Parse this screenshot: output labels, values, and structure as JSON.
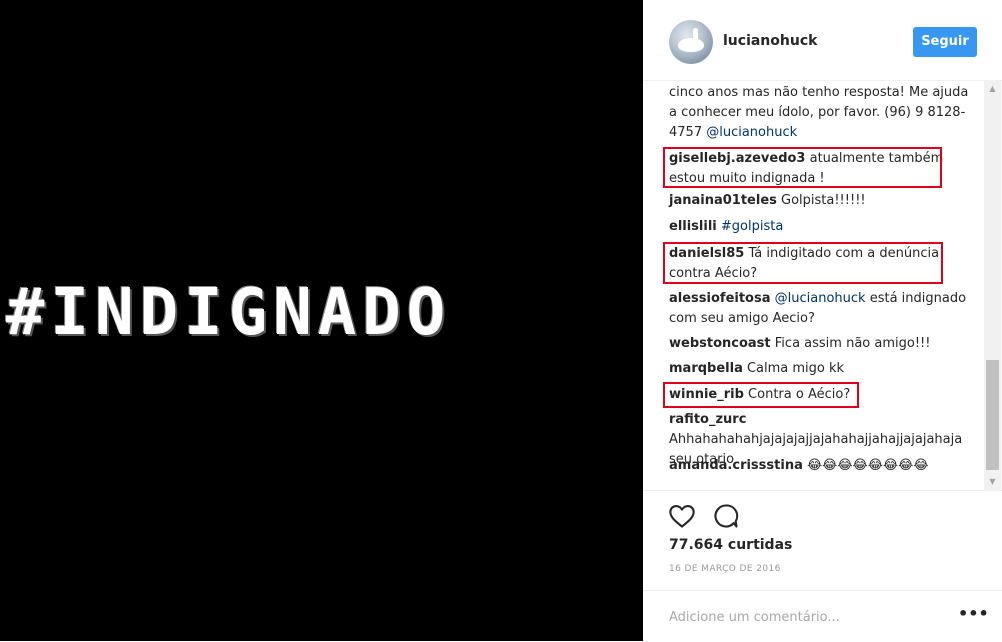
{
  "media": {
    "text": "#INDIGNADO"
  },
  "header": {
    "username": "lucianohuck",
    "follow_label": "Seguir"
  },
  "comments": [
    {
      "user": "",
      "parts": [
        {
          "text": "cinco anos mas não tenho resposta! Me ajuda a conhecer meu ídolo, por favor. (96) 9 8128-4757 "
        },
        {
          "text": "@lucianohuck",
          "mention": true
        }
      ]
    },
    {
      "user": "gisellebj.azevedo3",
      "parts": [
        {
          "text": " atualmente também estou muito indignada !"
        }
      ]
    },
    {
      "user": "janaina01teles",
      "parts": [
        {
          "text": " Golpista!!!!!!"
        }
      ]
    },
    {
      "user": "ellislili",
      "parts": [
        {
          "text": " "
        },
        {
          "text": "#golpista",
          "mention": true
        }
      ]
    },
    {
      "user": "danielsl85",
      "parts": [
        {
          "text": " Tá indigitado com a denúncia contra Aécio?"
        }
      ]
    },
    {
      "user": "alessiofeitosa",
      "parts": [
        {
          "text": " "
        },
        {
          "text": "@lucianohuck",
          "mention": true
        },
        {
          "text": " está indignado com seu amigo Aecio?"
        }
      ]
    },
    {
      "user": "webstoncoast",
      "parts": [
        {
          "text": " Fica assim não amigo!!!"
        }
      ]
    },
    {
      "user": "marqbella",
      "parts": [
        {
          "text": " Calma migo kk"
        }
      ]
    },
    {
      "user": "winnie_rib",
      "parts": [
        {
          "text": " Contra o Aécio?"
        }
      ]
    },
    {
      "user": "rafito_zurc",
      "parts": [
        {
          "text": " Ahhahahahahjajajajajjajahahajjahajjajajahaja seu otario"
        }
      ]
    },
    {
      "user": "amanda.crissstina",
      "parts": [
        {
          "text": " 😂😂😂😂😂😂😂😂"
        }
      ]
    }
  ],
  "actions": {
    "likes": "77.664 curtidas",
    "date": "16 DE MARÇO DE 2016"
  },
  "add_comment": {
    "placeholder": "Adicione um comentário...",
    "more_label": "•••"
  },
  "colors": {
    "follow_button": "#3897f0",
    "highlight_border": "#e0001a",
    "mention": "#003569",
    "media_background": "#000000"
  }
}
